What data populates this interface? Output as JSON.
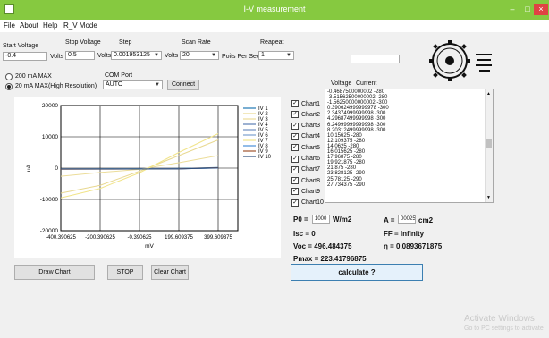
{
  "window": {
    "title": "I-V measurement",
    "minimize": "–",
    "maximize": "□",
    "close": "×"
  },
  "menu": [
    "File",
    "About",
    "Help",
    "R_V Mode"
  ],
  "settings": {
    "start_voltage_label": "Start Voltage",
    "start_voltage_value": "-0.4",
    "stop_voltage_label": "Stop Voltage",
    "stop_voltage_value": "0.5",
    "step_label": "Step",
    "step_value": "0.001953125",
    "scan_rate_label": "Scan Rate",
    "scan_rate_value": "20",
    "repeat_label": "Reapeat",
    "repeat_value": "1",
    "volts_unit": "Volts",
    "volts_unit2": "Volts",
    "volts_unit3": "Volts",
    "points_per_sec": "Poits Per Sec"
  },
  "range": {
    "option_200": "200 mA MAX",
    "option_20": "20 mA MAX(High Resolution)",
    "selected": "20 mA MAX(High Resolution)"
  },
  "com_port": {
    "label": "COM Port",
    "value": "AUTO",
    "connect_label": "Connect"
  },
  "top_right_input": "",
  "chart_data": {
    "type": "line",
    "x": [
      -400.390625,
      -200.390625,
      -0.390625,
      199.609375,
      399.609375
    ],
    "xlabel": "mV",
    "ylabel": "uA",
    "xlim": [
      -400.390625,
      499.609375
    ],
    "ylim": [
      -20000,
      20000
    ],
    "yticks": [
      "20000",
      "10000",
      "0",
      "-10000",
      "-20000"
    ],
    "xticks": [
      "-400.390625",
      "-200.390625",
      "-0.390625",
      "199.609375",
      "399.609375"
    ],
    "grid": true,
    "legend_position": "right",
    "series": [
      {
        "name": "IV 1",
        "color": "#1f77b4",
        "values": [
          -300,
          -250,
          -200,
          -100,
          200
        ]
      },
      {
        "name": "IV 2",
        "color": "#e8d890",
        "values": [
          -8000,
          -5500,
          -1000,
          4000,
          9000
        ]
      },
      {
        "name": "IV 3",
        "color": "#ecdd9a",
        "values": [
          -2600,
          -1400,
          -400,
          1700,
          4000
        ]
      },
      {
        "name": "IV 4",
        "color": "#5b7db3",
        "values": [
          -300,
          -280,
          -280,
          -200,
          100
        ]
      },
      {
        "name": "IV 5",
        "color": "#6f8fc0",
        "values": [
          -300,
          -280,
          -290,
          -220,
          50
        ]
      },
      {
        "name": "IV 6",
        "color": "#7aa0cf",
        "values": [
          -250,
          -240,
          -250,
          -200,
          0
        ]
      },
      {
        "name": "IV 7",
        "color": "#f1e48a",
        "values": [
          -9500,
          -6500,
          -1500,
          5000,
          11000
        ]
      },
      {
        "name": "IV 8",
        "color": "#4a90d9",
        "values": [
          -290,
          -285,
          -280,
          -230,
          80
        ]
      },
      {
        "name": "IV 9",
        "color": "#a0522d",
        "values": [
          -350,
          -320,
          -300,
          -220,
          150
        ]
      },
      {
        "name": "IV 10",
        "color": "#2f4f7f",
        "values": [
          -290,
          -280,
          -280,
          -240,
          60
        ]
      }
    ]
  },
  "checks": [
    "Chart1",
    "Chart2",
    "Chart3",
    "Chart4",
    "Chart5",
    "Chart6",
    "Chart7",
    "Chart8",
    "Chart9",
    "Chart10"
  ],
  "list": {
    "header_voltage": "Voltage",
    "header_current": "Current",
    "lines": [
      "-0.4687500000002  -280",
      "-3.51562500000002  -280",
      "-1.56250000000002  -300",
      "0.390624999999978  -300",
      "2.34374999999998  -300",
      "4.29687499999998  -300",
      "6.24999999999998  -300",
      "8.20312499999998  -300",
      "10.15625  -280",
      "12.109375  -280",
      "14.0625  -280",
      "16.015625  -280",
      "17.96875  -280",
      "19.921875  -280",
      "21.875  -280",
      "23.828125  -290",
      "25.78125  -290",
      "27.734375  -290"
    ]
  },
  "results": {
    "p0_label": "P0 =",
    "p0_value": "1000",
    "p0_unit": "W/m2",
    "a_label": "A =",
    "a_value": "00025",
    "a_unit": "cm2",
    "isc": "Isc = 0",
    "ff": "FF = Infinity",
    "voc": "Voc = 496.484375",
    "eta": "η = 0.0893671875",
    "pmax": "Pmax = 223.41796875"
  },
  "buttons": {
    "draw": "Draw Chart",
    "stop": "STOP",
    "clear": "Clear Chart",
    "calculate": "calculate ?"
  },
  "watermark": {
    "line1": "Activate Windows",
    "line2": "Go to PC settings to activate"
  }
}
